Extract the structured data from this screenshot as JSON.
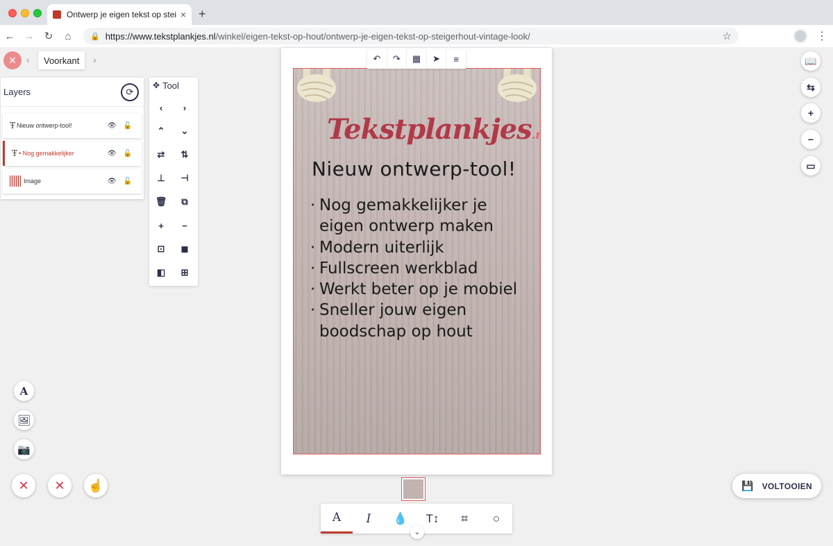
{
  "browser": {
    "tab_title": "Ontwerp je eigen tekst op steig",
    "tab_close": "×",
    "new_tab": "+",
    "url_host": "https://www.tekstplankjes.nl",
    "url_path": "/winkel/eigen-tekst-op-hout/ontwerp-je-eigen-tekst-op-steigerhout-vintage-look/",
    "back_icon": "←",
    "forward_icon": "→",
    "reload_icon": "↻",
    "home_icon": "⌂",
    "lock_icon": "🔒",
    "star_icon": "☆",
    "menu_icon": "⋮"
  },
  "side_nav": {
    "close": "✕",
    "prev": "‹",
    "label": "Voorkant",
    "next": "›"
  },
  "layers": {
    "title": "Layers",
    "refresh": "⟳",
    "items": [
      {
        "type": "Ŧ",
        "name": "Nieuw ontwerp-tool!",
        "eye": "👁",
        "lock": "🔓"
      },
      {
        "type": "Ŧ",
        "name": "• Nog gemakkelijker",
        "eye": "👁",
        "lock": "🔓"
      },
      {
        "type": "",
        "name": "Image",
        "eye": "👁",
        "lock": "🔓"
      }
    ]
  },
  "tool": {
    "title": "Tool",
    "move_icon": "✥",
    "buttons": [
      "‹",
      "›",
      "⌃",
      "⌄",
      "⇄",
      "⇅",
      "⊥",
      "⊣",
      "🗑",
      "⧉",
      "+",
      "−",
      "⊡",
      "◼",
      "◧",
      "⊞"
    ]
  },
  "canvas_tools": [
    "↶",
    "↷",
    "▦",
    "➤",
    "≡"
  ],
  "board": {
    "logo_text": "Tekstplankjes",
    "logo_suffix": ".nl",
    "headline": "Nieuw ontwerp-tool!",
    "bullet_char": "·",
    "bullets": [
      "Nog gemakkelijker je",
      "eigen ontwerp maken",
      "Modern uiterlijk",
      "Fullscreen werkblad",
      "Werkt beter op je mobiel",
      "Sneller jouw eigen",
      "boodschap op hout"
    ]
  },
  "right_tools": [
    "📖",
    "⇆",
    "+",
    "−",
    "▭"
  ],
  "left_tools": [
    "A",
    "🖼",
    "📷"
  ],
  "clear_buttons": [
    "✕",
    "✕",
    "☝"
  ],
  "bottom_toolbar": [
    "A",
    "I",
    "💧",
    "T↕",
    "⌗",
    "○"
  ],
  "expand": "⌄",
  "finish": {
    "icon": "💾",
    "label": "VOLTOOIEN"
  }
}
